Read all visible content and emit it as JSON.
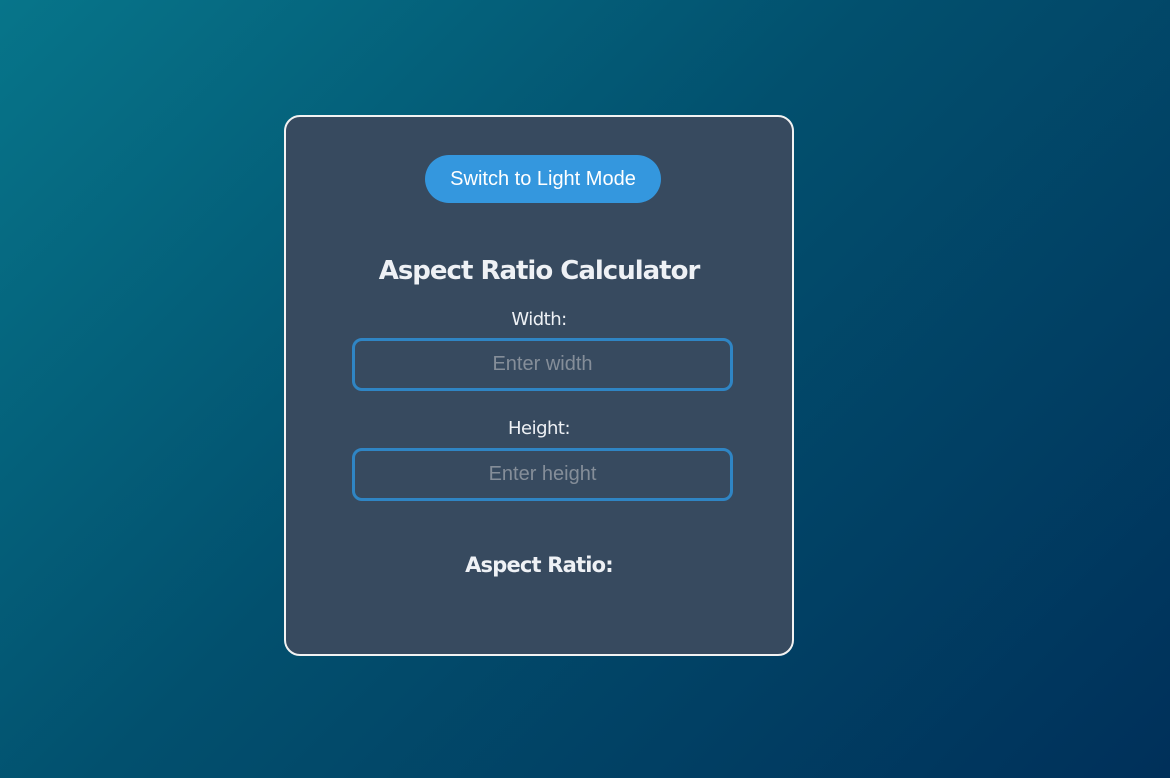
{
  "theme_toggle": {
    "label": "Switch to Light Mode"
  },
  "calculator": {
    "title": "Aspect Ratio Calculator",
    "width": {
      "label": "Width:",
      "placeholder": "Enter width",
      "value": ""
    },
    "height": {
      "label": "Height:",
      "placeholder": "Enter height",
      "value": ""
    },
    "result": {
      "label": "Aspect Ratio:",
      "value": ""
    }
  },
  "colors": {
    "background_start": "#07758a",
    "background_end": "#00305a",
    "card": "#374a5f",
    "card_border": "#f2f2f2",
    "accent": "#3497de",
    "input_border": "#2f85c4",
    "text": "#eef1f5",
    "placeholder": "#858e99"
  }
}
